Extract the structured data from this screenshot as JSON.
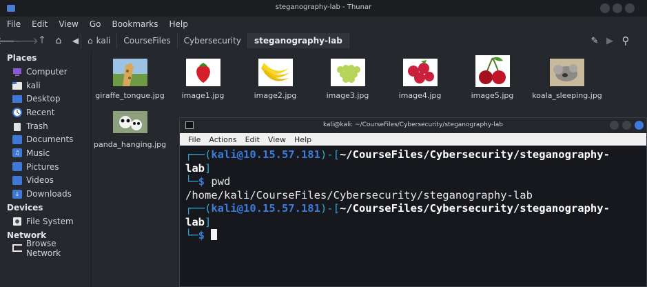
{
  "window": {
    "title": "steganography-lab - Thunar"
  },
  "menu": [
    "File",
    "Edit",
    "View",
    "Go",
    "Bookmarks",
    "Help"
  ],
  "breadcrumbs": [
    "kali",
    "CourseFiles",
    "Cybersecurity",
    "steganography-lab"
  ],
  "sidebar": {
    "places_heading": "Places",
    "places": [
      {
        "label": "Computer",
        "icon": "computer-icon"
      },
      {
        "label": "kali",
        "icon": "home-folder-icon"
      },
      {
        "label": "Desktop",
        "icon": "desktop-icon"
      },
      {
        "label": "Recent",
        "icon": "recent-icon"
      },
      {
        "label": "Trash",
        "icon": "trash-icon"
      },
      {
        "label": "Documents",
        "icon": "documents-folder-icon"
      },
      {
        "label": "Music",
        "icon": "music-folder-icon"
      },
      {
        "label": "Pictures",
        "icon": "pictures-folder-icon"
      },
      {
        "label": "Videos",
        "icon": "videos-folder-icon"
      },
      {
        "label": "Downloads",
        "icon": "downloads-folder-icon"
      }
    ],
    "devices_heading": "Devices",
    "devices": [
      {
        "label": "File System",
        "icon": "drive-icon"
      }
    ],
    "network_heading": "Network",
    "network": [
      {
        "label": "Browse Network",
        "icon": "network-icon"
      }
    ]
  },
  "files": [
    {
      "name": "giraffe_tongue.jpg",
      "thumb": "giraffe-thumbnail"
    },
    {
      "name": "image1.jpg",
      "thumb": "strawberry-thumbnail"
    },
    {
      "name": "image2.jpg",
      "thumb": "bananas-thumbnail"
    },
    {
      "name": "image3.jpg",
      "thumb": "grapes-thumbnail"
    },
    {
      "name": "image4.jpg",
      "thumb": "raspberries-thumbnail"
    },
    {
      "name": "image5.jpg",
      "thumb": "cherries-thumbnail"
    },
    {
      "name": "koala_sleeping.jpg",
      "thumb": "koala-thumbnail"
    },
    {
      "name": "panda_hanging.jpg",
      "thumb": "panda-thumbnail"
    }
  ],
  "terminal": {
    "title": "kali@kali: ~/CourseFiles/Cybersecurity/steganography-lab",
    "menu": [
      "File",
      "Actions",
      "Edit",
      "View",
      "Help"
    ],
    "prompt_user": "kali@10.15.57.181",
    "prompt_dir": "~/CourseFiles/Cybersecurity/steganography-",
    "prompt_dir_wrap": "lab",
    "command": "pwd",
    "output": "/home/kali/CourseFiles/Cybersecurity/steganography-lab"
  },
  "colors": {
    "accent": "#3b7bdc",
    "prompt_frame": "#2ea8d6",
    "background": "#25282d"
  }
}
